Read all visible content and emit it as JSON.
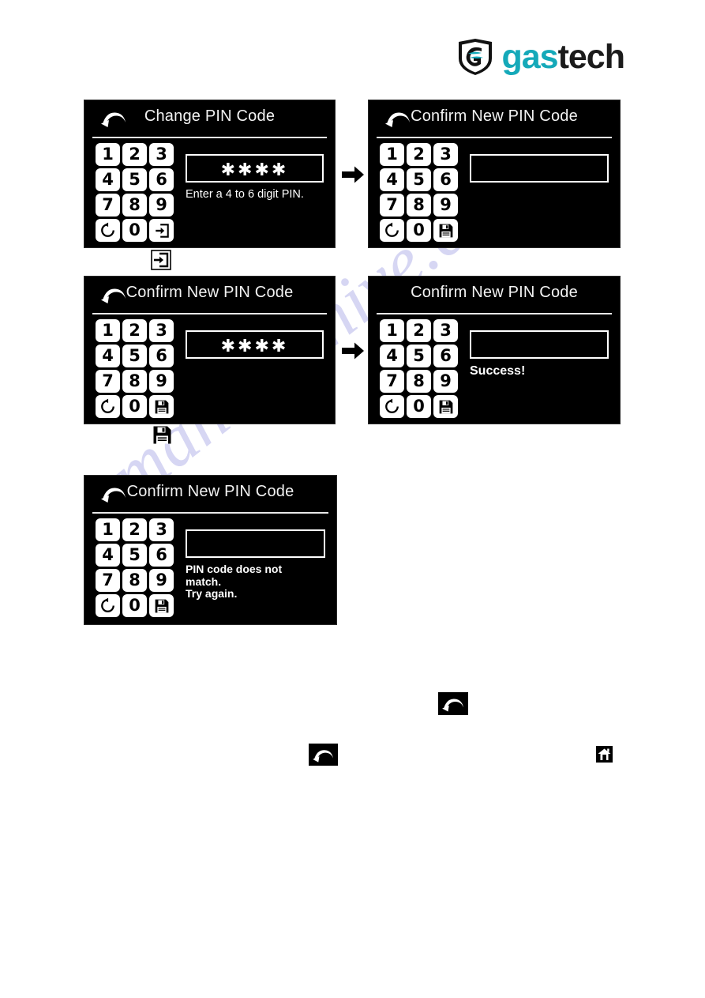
{
  "brand": {
    "name_part1": "gas",
    "name_part2": "tech",
    "logo_mark": "gastech-shield-icon",
    "accent_color": "#15A9B9",
    "text_color": "#1b1b1b"
  },
  "watermark": {
    "text": "manualshive.com",
    "color": "#c9c9ef"
  },
  "keypad": {
    "digits": [
      "1",
      "2",
      "3",
      "4",
      "5",
      "6",
      "7",
      "8",
      "9"
    ],
    "zero": "0",
    "reset_icon": "reset-circular-arrow-icon",
    "enter_icon": "enter-login-arrow-icon",
    "save_icon": "save-floppy-disk-icon"
  },
  "screens": [
    {
      "id": "screen1",
      "title": "Change PIN Code",
      "has_back": true,
      "back_icon": "back-arrow-icon",
      "pin_value": "✱✱✱✱",
      "hint": "Enter a 4 to 6 digit PIN.",
      "hint_style": "normal",
      "action_key": "enter-login-arrow-icon"
    },
    {
      "id": "screen2",
      "title": "Confirm New PIN Code",
      "has_back": true,
      "back_icon": "back-arrow-icon",
      "pin_value": "",
      "hint": "",
      "hint_style": "normal",
      "action_key": "save-floppy-disk-icon"
    },
    {
      "id": "screen3",
      "title": "Confirm New PIN Code",
      "has_back": true,
      "back_icon": "back-arrow-icon",
      "pin_value": "✱✱✱✱",
      "hint": "",
      "hint_style": "normal",
      "action_key": "save-floppy-disk-icon"
    },
    {
      "id": "screen4",
      "title": "Confirm New PIN Code",
      "has_back": false,
      "back_icon": "",
      "pin_value": "",
      "hint": "Success!",
      "hint_style": "success",
      "action_key": "save-floppy-disk-icon"
    },
    {
      "id": "screen5",
      "title": "Confirm New PIN Code",
      "has_back": true,
      "back_icon": "back-arrow-icon",
      "pin_value": "",
      "hint": "PIN code does not match.\nTry again.",
      "hint_style": "bold",
      "action_key": "save-floppy-disk-icon"
    }
  ],
  "flow_arrows": [
    {
      "name": "flow-arrow-right",
      "between": "screen1-to-screen2"
    },
    {
      "name": "flow-arrow-right",
      "between": "screen3-to-screen4"
    }
  ],
  "caption_icons": [
    {
      "name": "enter-login-arrow-icon",
      "below": "screen1"
    },
    {
      "name": "save-floppy-disk-icon",
      "below": "screen3"
    }
  ],
  "standalone_icons": [
    {
      "name": "back-arrow-tile-icon"
    },
    {
      "name": "back-arrow-tile-icon"
    },
    {
      "name": "home-tile-icon"
    }
  ]
}
